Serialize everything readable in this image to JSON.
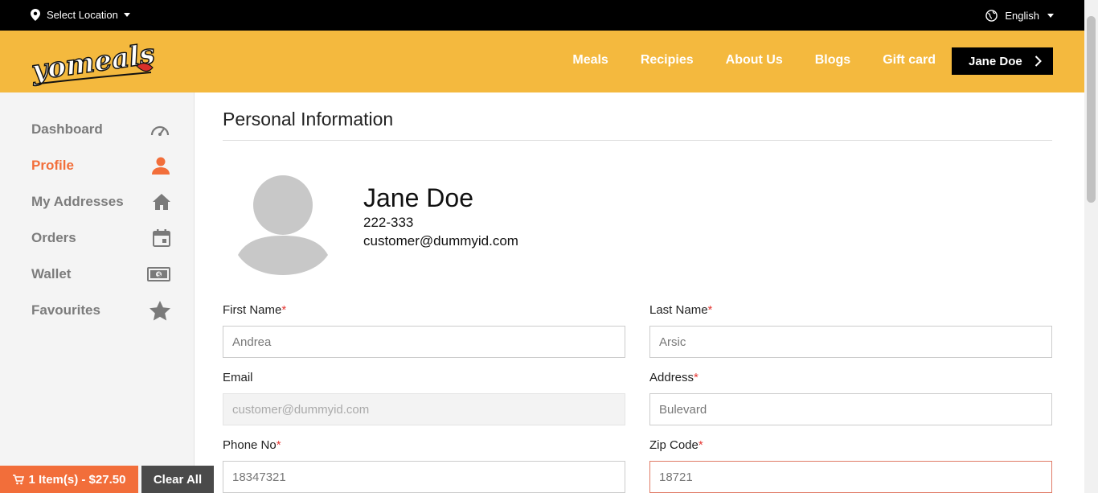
{
  "topbar": {
    "location_label": "Select Location",
    "language": "English"
  },
  "brand": {
    "logo_text": "yomeals"
  },
  "nav": {
    "items": [
      {
        "label": "Meals"
      },
      {
        "label": "Recipies"
      },
      {
        "label": "About Us"
      },
      {
        "label": "Blogs"
      },
      {
        "label": "Gift card"
      }
    ],
    "user_button": "Jane Doe"
  },
  "sidebar": {
    "items": [
      {
        "label": "Dashboard",
        "icon": "speedometer-icon"
      },
      {
        "label": "Profile",
        "icon": "user-icon",
        "active": true
      },
      {
        "label": "My Addresses",
        "icon": "home-icon"
      },
      {
        "label": "Orders",
        "icon": "calendar-icon"
      },
      {
        "label": "Wallet",
        "icon": "money-icon"
      },
      {
        "label": "Favourites",
        "icon": "star-icon"
      }
    ]
  },
  "profile": {
    "section_title": "Personal Information",
    "name": "Jane Doe",
    "phone": "222-333",
    "email": "customer@dummyid.com"
  },
  "form": {
    "first_name": {
      "label": "First Name",
      "required": "*",
      "value": "Andrea"
    },
    "last_name": {
      "label": "Last Name",
      "required": "*",
      "value": "Arsic"
    },
    "email": {
      "label": "Email",
      "value": "customer@dummyid.com",
      "disabled": true
    },
    "address": {
      "label": "Address",
      "required": "*",
      "value": "Bulevard"
    },
    "phone": {
      "label": "Phone No",
      "required": "*",
      "value": "18347321"
    },
    "zip": {
      "label": "Zip Code",
      "required": "*",
      "value": "18721"
    }
  },
  "cart": {
    "summary": "1 Item(s) - $27.50",
    "clear_label": "Clear All"
  },
  "colors": {
    "brand_yellow": "#f4b93e",
    "accent_orange": "#f26e3a",
    "black": "#000000"
  }
}
